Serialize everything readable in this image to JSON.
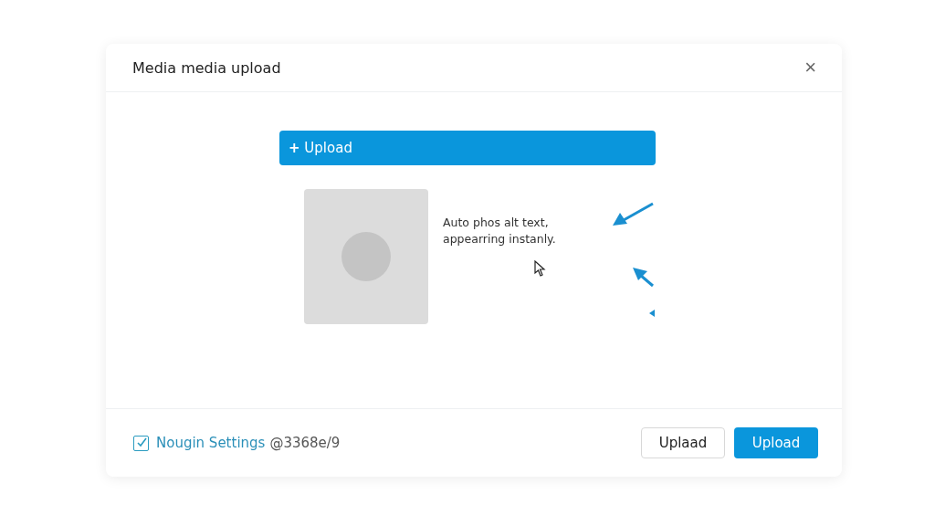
{
  "dialog": {
    "title": "Media media upload",
    "close": "×"
  },
  "upload_bar": {
    "icon": "+",
    "label": "Upload"
  },
  "preview": {
    "kind": "picture",
    "caption": "Auto phos alt text, appearring instanly."
  },
  "footer": {
    "checkbox": {
      "checked": true,
      "label": "Nougin Settings",
      "suffix": "@3368e/9"
    },
    "buttons": [
      {
        "label": "Uplaad",
        "kind": "secondary"
      },
      {
        "label": "Upload",
        "kind": "primary"
      }
    ]
  }
}
